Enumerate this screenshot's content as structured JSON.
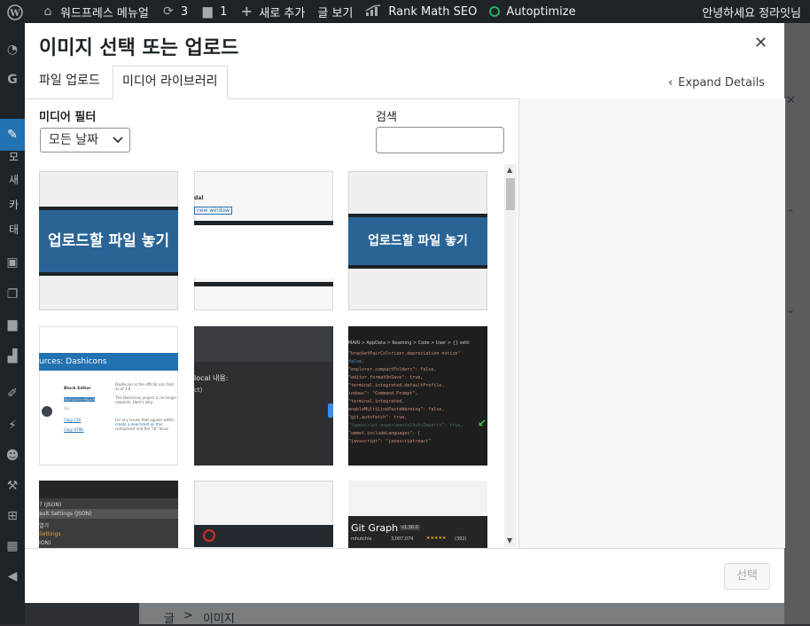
{
  "adminbar": {
    "site_name": "워드프레스 메뉴얼",
    "updates_count": "3",
    "comments_count": "1",
    "new_label": "새로 추가",
    "view_post": "글 보기",
    "rankmath": "Rank Math SEO",
    "autoptimize": "Autoptimize",
    "greeting": "안녕하세요 정라잇님"
  },
  "sidebar_text": [
    "모",
    "새",
    "카",
    "태"
  ],
  "modal": {
    "title": "이미지 선택 또는 업로드",
    "tabs": [
      {
        "label": "파일 업로드",
        "active": false
      },
      {
        "label": "미디어 라이브러리",
        "active": true
      }
    ],
    "expand_details": "Expand Details",
    "filter": {
      "label": "미디어 필터",
      "selected": "모든 날짜"
    },
    "search": {
      "label": "검색",
      "placeholder": ""
    },
    "select_button": "선택"
  },
  "thumbs": {
    "t1": "업로드할 파일 놓기",
    "t2_top": "dal",
    "t2_btn": "new window",
    "t3": "업로드할 파일 놓기",
    "t4_header": "urces: Dashicons",
    "t4_block": "Block Editor",
    "t4_link1": "dashicons-ellipsis",
    "t4_all": "ALL",
    "t4_link2": "Copy CSS",
    "t4_link3": "Copy HTML",
    "t4_p1": "Dashicons is the official icon font",
    "t4_p2": "as of 3.8",
    "t4_p3": "The Dashicons project is no longer",
    "t4_p4": "requests. Here's why:",
    "t4_p5": "For any issues that appear within",
    "t4_p6": "create a new ticket on trac",
    "t4_p7": "component and the \"UI\" focus",
    "t5_line1": "local 내용:",
    "t5_line2": "ct)",
    "t6_path": "MAIN > AppData > Roaming > Code > User > {} setti",
    "t6_lines": [
      "\"bracketPairColorizer.depreciation-notice\"",
      "false,",
      "\"explorer.compactFolders\": false,",
      "\"editor.formatOnSave\": true,",
      "\"terminal.integrated.defaultProfile.",
      "indows\": \"Command Prompt\",",
      "\"terminal.integrated.",
      "enableMultiLinePasteWarning\": false,",
      "\"git.autofetch\": true,",
      "\"typescript.experimentalAutoImports\": true,",
      "\"emmet.includeLanguages\": {",
      "  \"javascript\": \"javascriptreact\""
    ],
    "t7_line1": "7 (JSON)",
    "t7_line2": "ault Settings (JSON)",
    "t7_line3": "열기",
    "t7_line4": "Settings",
    "t7_line5": "ION)",
    "t9_title": "Git Graph",
    "t9_version": "v1.30.0",
    "t9_author": "mhutchie",
    "t9_downloads": "3,007,074",
    "t9_stars": "★★★★★",
    "t9_reviews": "(392)"
  },
  "behind": {
    "crumb1": "글",
    "crumb_sep": ">",
    "crumb2": "이미지"
  },
  "colors": {
    "adminbar_bg": "#1d2327",
    "accent": "#2271b1",
    "drop_zone": "#2a6496",
    "code_bg": "#1e1e1e"
  }
}
